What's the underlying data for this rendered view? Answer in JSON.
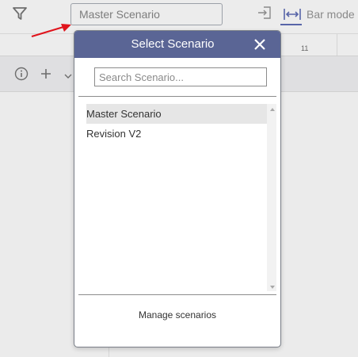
{
  "topbar": {
    "filter_icon": "filter-icon",
    "scenario_select": {
      "value": "Master Scenario"
    },
    "exit_icon": "exit-icon",
    "bar_mode": {
      "label": "Bar mode",
      "icon": "arrows-horizontal-icon"
    }
  },
  "header_strip": {
    "column_label": "11"
  },
  "toolbar": {
    "info_icon": "info-icon",
    "add_icon": "plus-icon",
    "dropdown_icon": "chevron-down-icon"
  },
  "modal": {
    "title": "Select Scenario",
    "close_icon": "close-icon",
    "search": {
      "placeholder": "Search Scenario...",
      "value": ""
    },
    "items": [
      {
        "label": "Master Scenario",
        "selected": true
      },
      {
        "label": "Revision V2",
        "selected": false
      }
    ],
    "manage_label": "Manage scenarios"
  },
  "colors": {
    "modal_header": "#5a6595",
    "accent": "#5865a8",
    "arrow": "#e0141c",
    "selected_row": "#e6e6e6"
  }
}
